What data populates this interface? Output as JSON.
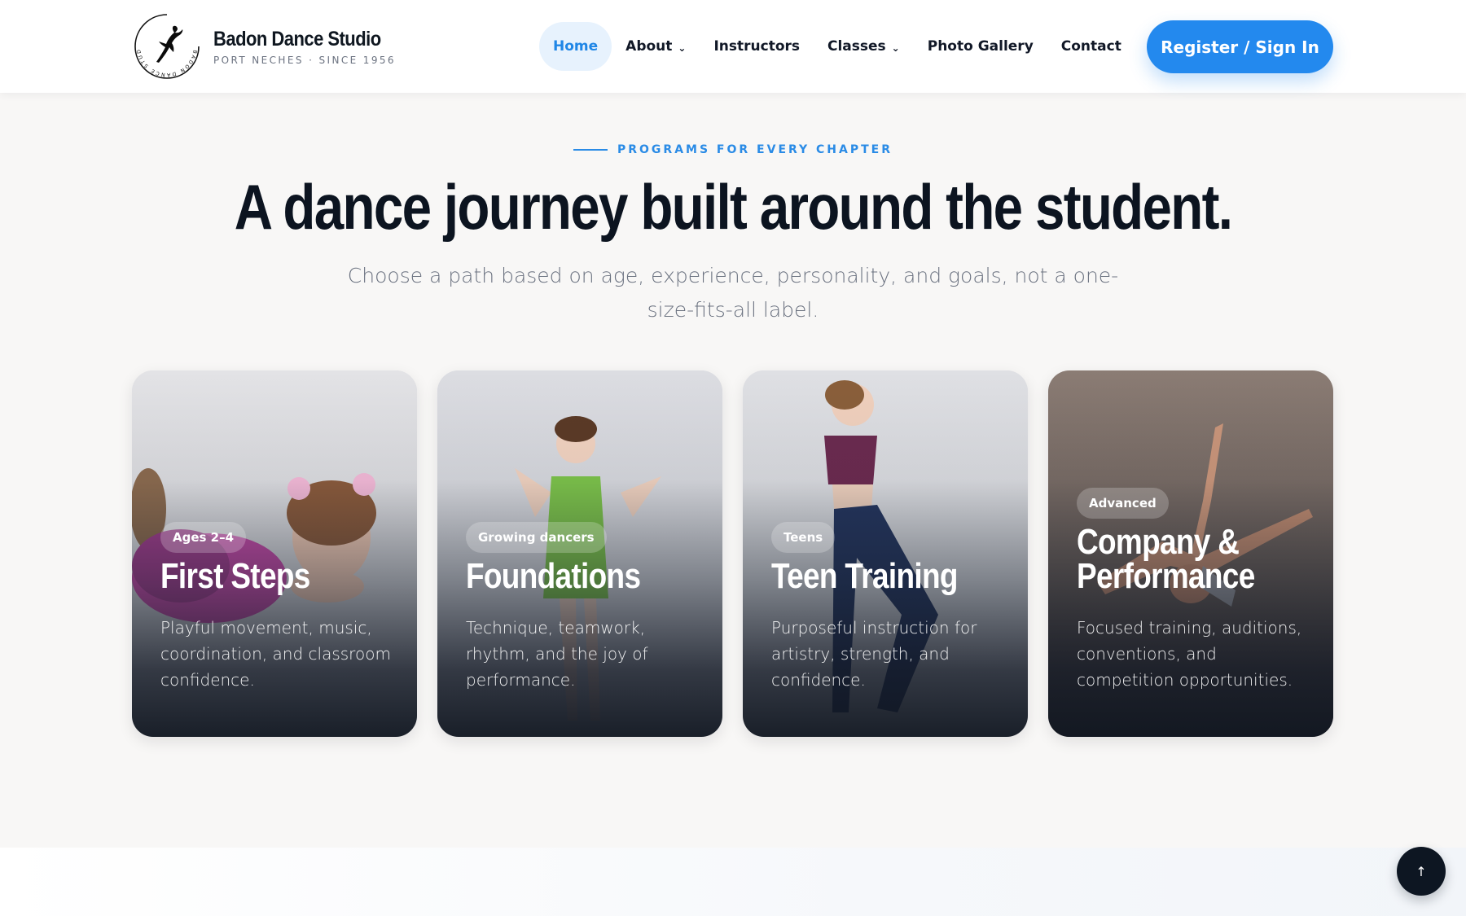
{
  "brand": {
    "name": "Badon Dance Studio",
    "tagline": "PORT NECHES · SINCE 1956",
    "logo_ring_text": "BADON DANCE STUDIO",
    "logo_icon": "dancer-silhouette-icon"
  },
  "nav": {
    "items": [
      {
        "label": "Home",
        "active": true
      },
      {
        "label": "About",
        "dropdown": true
      },
      {
        "label": "Instructors"
      },
      {
        "label": "Classes",
        "dropdown": true
      },
      {
        "label": "Photo Gallery"
      },
      {
        "label": "Contact"
      }
    ],
    "dropdown_glyph": "⌄",
    "cta_label": "Register / Sign In"
  },
  "section": {
    "eyebrow": "PROGRAMS FOR EVERY CHAPTER",
    "title": "A dance journey built around the student.",
    "subtitle": "Choose a path based on age, experience, personality, and goals, not a one-size-fits-all label."
  },
  "cards": [
    {
      "badge": "Ages 2–4",
      "title_lines": [
        "First Steps"
      ],
      "description": "Playful movement, music, coordination, and classroom confidence."
    },
    {
      "badge": "Growing dancers",
      "title_lines": [
        "Foundations"
      ],
      "description": "Technique, teamwork, rhythm, and the joy of performance."
    },
    {
      "badge": "Teens",
      "title_lines": [
        "Teen Training"
      ],
      "description": "Purposeful instruction for artistry, strength, and confidence."
    },
    {
      "badge": "Advanced",
      "title_lines": [
        "Company &",
        "Performance"
      ],
      "description": "Focused training, auditions, conventions, and competition opportunities."
    }
  ],
  "back_to_top": {
    "glyph": "↑"
  },
  "colors": {
    "accent": "#2389ee",
    "nav_active_bg": "#e7f2fd",
    "page_bg": "#f8f7f6",
    "heading": "#0c1420",
    "muted": "#6b7280"
  }
}
